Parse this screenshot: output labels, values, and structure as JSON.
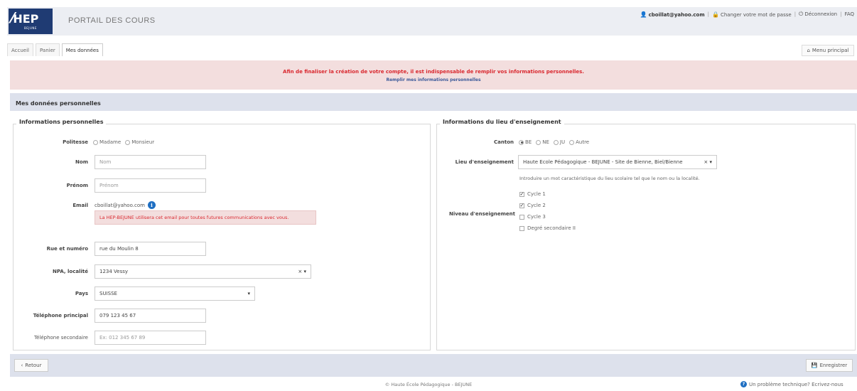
{
  "header": {
    "logo_text": "HEP",
    "logo_sub": "BEJUNE",
    "title": "PORTAIL DES COURS",
    "user_email": "cboillat@yahoo.com",
    "change_password": "Changer votre mot de passe",
    "logout": "Déconnexion",
    "faq": "FAQ",
    "separator": "|"
  },
  "tabs": [
    {
      "label": "Accueil"
    },
    {
      "label": "Panier"
    },
    {
      "label": "Mes données"
    }
  ],
  "menu_button": "Menu principal",
  "alert": {
    "text": "Afin de finaliser la création de votre compte, il est indispensable de remplir vos informations personnelles.",
    "link": "Remplir mes informations personnelles"
  },
  "panel_title": "Mes données personnelles",
  "personal": {
    "legend": "Informations personnelles",
    "politesse_label": "Politesse",
    "politesse_options": [
      "Madame",
      "Monsieur"
    ],
    "nom_label": "Nom",
    "nom_placeholder": "Nom",
    "prenom_label": "Prénom",
    "prenom_placeholder": "Prénom",
    "email_label": "Email",
    "email_value": "cboillat@yahoo.com",
    "email_warning": "La HEP-BEJUNE utilisera cet email pour toutes futures communications avec vous.",
    "rue_label": "Rue et numéro",
    "rue_value": "rue du Moulin 8",
    "npa_label": "NPA, localité",
    "npa_value": "1234 Vessy",
    "pays_label": "Pays",
    "pays_value": "SUISSE",
    "tel1_label": "Téléphone principal",
    "tel1_value": "079 123 45 67",
    "tel2_label": "Téléphone secondaire",
    "tel2_placeholder": "Ex: 012 345 67 89"
  },
  "school": {
    "legend": "Informations du lieu d'enseignement",
    "canton_label": "Canton",
    "canton_options": [
      "BE",
      "NE",
      "JU",
      "Autre"
    ],
    "lieu_label": "Lieu d'enseignement",
    "lieu_value": "Haute Ecole Pédagogique - BEJUNE - Site de Bienne, Biel/Bienne",
    "lieu_hint": "Introduire un mot caractéristique du lieu scolaire tel que le nom ou la localité.",
    "niveau_label": "Niveau d'enseignement",
    "levels": [
      {
        "label": "Cycle 1",
        "checked": true
      },
      {
        "label": "Cycle 2",
        "checked": true
      },
      {
        "label": "Cycle 3",
        "checked": false
      },
      {
        "label": "Degré secondaire II",
        "checked": false
      }
    ]
  },
  "buttons": {
    "back": "Retour",
    "save": "Enregistrer"
  },
  "footer": {
    "copyright": "© Haute École Pédagogique - BEJUNE",
    "help": "Un problème technique? Ecrivez-nous"
  }
}
